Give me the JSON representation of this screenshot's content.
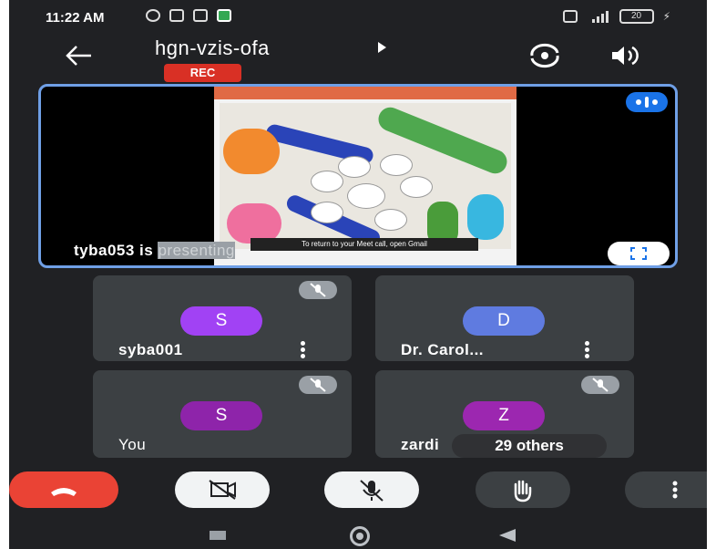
{
  "status_bar": {
    "time": "11:22 AM",
    "battery": "20"
  },
  "meeting": {
    "code": "hgn-vzis-ofa",
    "rec_badge": "REC"
  },
  "presentation": {
    "presenter_prefix": "tyba053 is",
    "presenter_suffix": "presenting",
    "toast": "To return to your Meet call, open Gmail"
  },
  "participants": [
    {
      "initial": "S",
      "name": "syba001",
      "avatar_color": "#a142f4"
    },
    {
      "initial": "D",
      "name": "Dr. Carol...",
      "avatar_color": "#5f7be0"
    },
    {
      "initial": "S",
      "name": "You",
      "avatar_color": "#8e24aa"
    },
    {
      "initial": "Z",
      "name": "zardi",
      "avatar_color": "#9c27b0",
      "others": "29 others"
    }
  ],
  "colors": {
    "accent_blue": "#1a73e8",
    "end_call_red": "#ea4335",
    "background": "#202124"
  },
  "icons": {
    "back": "arrow-left-icon",
    "flip": "flip-camera-icon",
    "speaker": "speaker-icon",
    "end_call": "phone-hangup-icon",
    "camera_off": "camera-off-icon",
    "mic_off": "mic-off-icon",
    "hand": "raise-hand-icon",
    "more": "more-vert-icon"
  }
}
